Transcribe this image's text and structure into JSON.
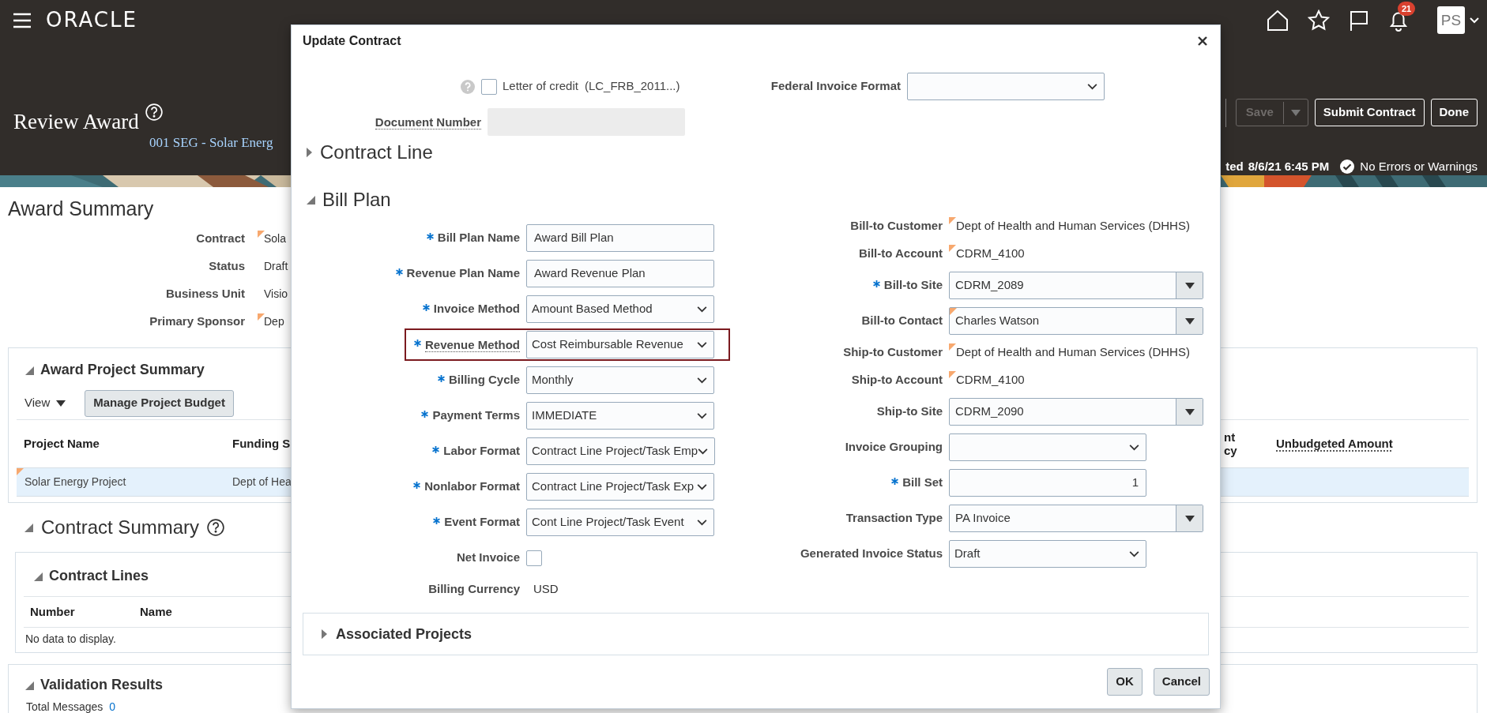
{
  "header": {
    "logo": "ORACLE",
    "notification_count": "21",
    "user_initials": "PS",
    "page_title": "Review Award",
    "award_name": "001 SEG - Solar Energ",
    "actions": [
      {
        "label": "Save",
        "kind": "split",
        "disabled": true
      },
      {
        "label": "Submit Contract",
        "kind": "plain",
        "disabled": false
      },
      {
        "label": "Done",
        "kind": "plain",
        "disabled": false
      }
    ],
    "saved_label": "ted",
    "saved_time": "8/6/21 6:45 PM",
    "validation_status": "No Errors or Warnings"
  },
  "award_summary": {
    "title": "Award Summary",
    "fields": [
      {
        "label": "Contract",
        "value": "Sola",
        "flagged": true
      },
      {
        "label": "Status",
        "value": "Draft",
        "flagged": false
      },
      {
        "label": "Business Unit",
        "value": "Visio",
        "flagged": false
      },
      {
        "label": "Primary Sponsor",
        "value": "Dep",
        "flagged": true
      }
    ]
  },
  "award_project_summary": {
    "title": "Award Project Summary",
    "expanded": true,
    "view_menu": "View",
    "button": "Manage Project Budget",
    "columns": [
      {
        "label": "Project Name",
        "has_help": false
      },
      {
        "label": "Funding S",
        "has_help": false
      },
      {
        "label": "nt cy",
        "has_help": false
      },
      {
        "label": "Unbudgeted Amount",
        "has_help": true
      }
    ],
    "rows": [
      {
        "cells": [
          "Solar Energy Project",
          "Dept of Hea"
        ],
        "selected": true,
        "flagged": true
      }
    ]
  },
  "contract_summary": {
    "title": "Contract Summary",
    "expanded": true,
    "contract_lines": {
      "title": "Contract Lines",
      "expanded": true,
      "columns": [
        "Number",
        "Name"
      ],
      "empty_text": "No data to display."
    }
  },
  "validation_results": {
    "title": "Validation Results",
    "expanded": true,
    "total_label": "Total Messages",
    "total_value": "0"
  },
  "dialog": {
    "title": "Update Contract",
    "letter_of_credit": {
      "label": "Letter of credit",
      "code": "(LC_FRB_2011...)",
      "checked": false
    },
    "federal_invoice_format": {
      "label": "Federal Invoice Format"
    },
    "document_number": {
      "label": "Document Number",
      "disabled": true
    },
    "sections": [
      {
        "title": "Contract Line",
        "expanded": false
      },
      {
        "title": "Bill Plan",
        "expanded": true
      }
    ],
    "left_fields": [
      {
        "label": "Bill Plan Name",
        "required": true,
        "kind": "text",
        "value": "Award Bill Plan",
        "has_help": false,
        "highlighted": false
      },
      {
        "label": "Revenue Plan Name",
        "required": true,
        "kind": "text",
        "value": "Award Revenue Plan",
        "has_help": false,
        "highlighted": false
      },
      {
        "label": "Invoice Method",
        "required": true,
        "kind": "select",
        "value": "Amount Based Method",
        "has_help": false,
        "highlighted": false
      },
      {
        "label": "Revenue Method",
        "required": true,
        "kind": "select",
        "value": "Cost Reimbursable Revenue",
        "has_help": true,
        "highlighted": true
      },
      {
        "label": "Billing Cycle",
        "required": true,
        "kind": "select",
        "value": "Monthly",
        "has_help": false,
        "highlighted": false
      },
      {
        "label": "Payment Terms",
        "required": true,
        "kind": "select",
        "value": "IMMEDIATE",
        "has_help": false,
        "highlighted": false
      },
      {
        "label": "Labor Format",
        "required": true,
        "kind": "select",
        "value": "Contract Line Project/Task Emp",
        "has_help": false,
        "highlighted": false
      },
      {
        "label": "Nonlabor Format",
        "required": true,
        "kind": "select",
        "value": "Contract Line Project/Task Exp",
        "has_help": false,
        "highlighted": false
      },
      {
        "label": "Event Format",
        "required": true,
        "kind": "select",
        "value": "Cont Line Project/Task Event",
        "has_help": false,
        "highlighted": false
      },
      {
        "label": "Net Invoice",
        "required": false,
        "kind": "checkbox",
        "checked": false,
        "has_help": false,
        "highlighted": false
      },
      {
        "label": "Billing Currency",
        "required": false,
        "kind": "display",
        "value": "USD",
        "has_help": false,
        "highlighted": false
      }
    ],
    "right_fields": [
      {
        "label": "Bill-to Customer",
        "required": false,
        "kind": "display",
        "value": "Dept of Health and Human Services (DHHS)",
        "flagged": true
      },
      {
        "label": "Bill-to Account",
        "required": false,
        "kind": "display",
        "value": "CDRM_4100",
        "flagged": true
      },
      {
        "label": "Bill-to Site",
        "required": true,
        "kind": "combobox",
        "value": "CDRM_2089",
        "flagged": false
      },
      {
        "label": "Bill-to Contact",
        "required": false,
        "kind": "combobox",
        "value": "Charles Watson",
        "flagged": true
      },
      {
        "label": "Ship-to Customer",
        "required": false,
        "kind": "display",
        "value": "Dept of Health and Human Services (DHHS)",
        "flagged": true
      },
      {
        "label": "Ship-to Account",
        "required": false,
        "kind": "display",
        "value": "CDRM_4100",
        "flagged": true
      },
      {
        "label": "Ship-to Site",
        "required": false,
        "kind": "combobox",
        "value": "CDRM_2090",
        "flagged": false
      },
      {
        "label": "Invoice Grouping",
        "required": false,
        "kind": "select",
        "flagged": false
      },
      {
        "label": "Bill Set",
        "required": true,
        "kind": "number",
        "value": "1",
        "flagged": false
      },
      {
        "label": "Transaction Type",
        "required": false,
        "kind": "combobox",
        "value": "PA Invoice",
        "flagged": false
      },
      {
        "label": "Generated Invoice Status",
        "required": false,
        "kind": "select",
        "value": "Draft",
        "flagged": false
      }
    ],
    "associated_projects": {
      "title": "Associated Projects",
      "expanded": false
    },
    "buttons": [
      {
        "label": "OK"
      },
      {
        "label": "Cancel"
      }
    ]
  }
}
